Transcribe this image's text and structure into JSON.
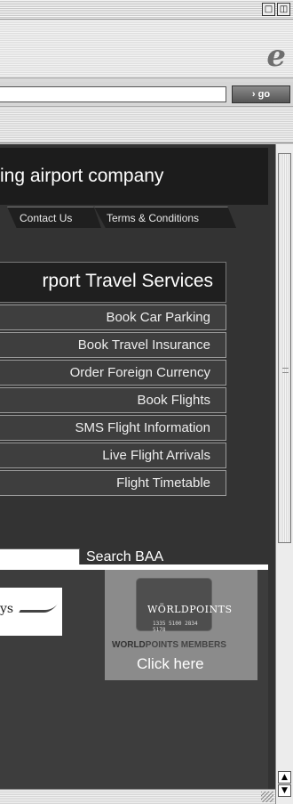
{
  "window": {
    "buttons": [
      "□",
      "◫"
    ]
  },
  "browser": {
    "logo_icon": "ie-logo-icon",
    "logo_glyph": "e",
    "go_label": "› go"
  },
  "page": {
    "banner_text": "ing airport company",
    "tabs": [
      {
        "label": "Contact Us"
      },
      {
        "label": "Terms & Conditions"
      }
    ],
    "services_title": "rport Travel Services",
    "services": [
      {
        "label": "Book Car Parking"
      },
      {
        "label": "Book Travel Insurance"
      },
      {
        "label": "Order Foreign Currency"
      },
      {
        "label": "Book Flights"
      },
      {
        "label": "SMS Flight Information"
      },
      {
        "label": "Live Flight Arrivals"
      },
      {
        "label": "Flight Timetable"
      }
    ],
    "search_label": "Search BAA",
    "ba_logo_text": "ys",
    "worldpoints": {
      "card_logo": "WÖRLDPOINTS",
      "card_number": "1335 5100 2834 5178",
      "caption_strong": "WORLD",
      "caption_rest": "POINTS MEMBERS",
      "click_here": "Click here"
    }
  },
  "scrollbar": {
    "up_glyph": "▲",
    "down_glyph": "▼"
  }
}
